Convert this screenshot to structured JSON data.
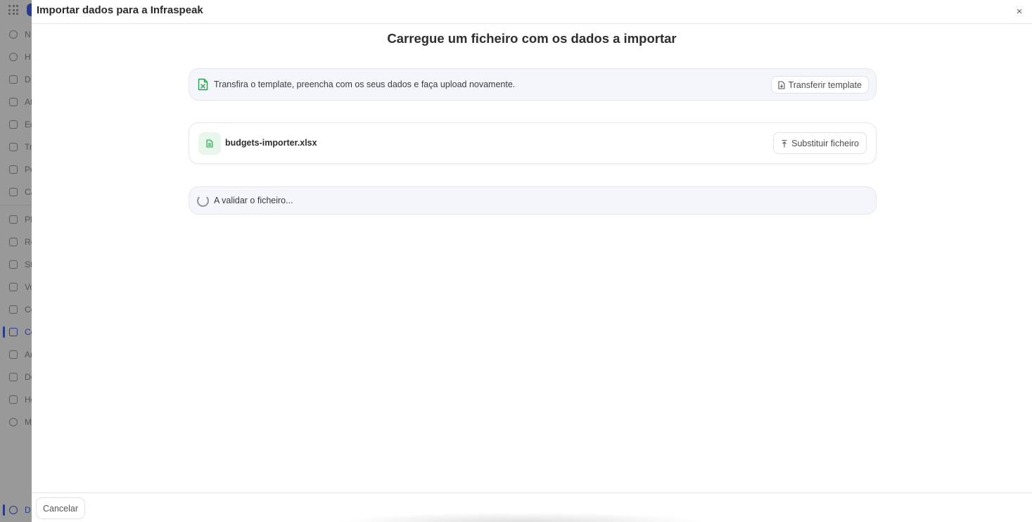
{
  "sidebar": {
    "items": [
      {
        "label": "N",
        "icon": "globe-icon",
        "active": false
      },
      {
        "label": "H",
        "icon": "history-icon",
        "active": false
      },
      {
        "label": "D",
        "icon": "dashboard-icon",
        "active": false
      },
      {
        "label": "At",
        "icon": "tools-icon",
        "active": false
      },
      {
        "label": "Ed",
        "icon": "building-icon",
        "active": false
      },
      {
        "label": "Tr",
        "icon": "calendar-icon",
        "active": false
      },
      {
        "label": "Po",
        "icon": "clipboard-icon",
        "active": false
      },
      {
        "label": "Ca",
        "icon": "database-icon",
        "active": false
      },
      {
        "label": "Pl",
        "icon": "plan-icon",
        "active": false
      },
      {
        "label": "Re",
        "icon": "bell-icon",
        "active": false
      },
      {
        "label": "St",
        "icon": "users-icon",
        "active": false
      },
      {
        "label": "Vo",
        "icon": "tag-icon",
        "active": false
      },
      {
        "label": "Co",
        "icon": "cart-icon",
        "active": false
      },
      {
        "label": "Cc",
        "icon": "wallet-icon",
        "active": true
      },
      {
        "label": "An",
        "icon": "chart-icon",
        "active": false
      },
      {
        "label": "Do",
        "icon": "document-icon",
        "active": false
      },
      {
        "label": "Ho",
        "icon": "home-icon",
        "active": false
      },
      {
        "label": "M",
        "icon": "map-pin-icon",
        "active": false
      }
    ],
    "bottom_item": {
      "label": "D",
      "icon": "settings-icon",
      "active": true
    }
  },
  "modal": {
    "title": "Importar dados para a Infraspeak",
    "close_symbol": "×",
    "heading": "Carregue um ficheiro com os dados a importar",
    "template_card": {
      "text": "Transfira o template, preencha com os seus dados e faça upload novamente.",
      "button_label": "Transferir template"
    },
    "file_card": {
      "file_name": "budgets-importer.xlsx",
      "button_label": "Substituir ficheiro"
    },
    "status_card": {
      "text": "A validar o ficheiro..."
    },
    "footer": {
      "cancel_label": "Cancelar"
    }
  },
  "colors": {
    "accent": "#2c4bd6",
    "excel_green": "#2e9d4f",
    "card_bg": "#f4f6fb"
  }
}
